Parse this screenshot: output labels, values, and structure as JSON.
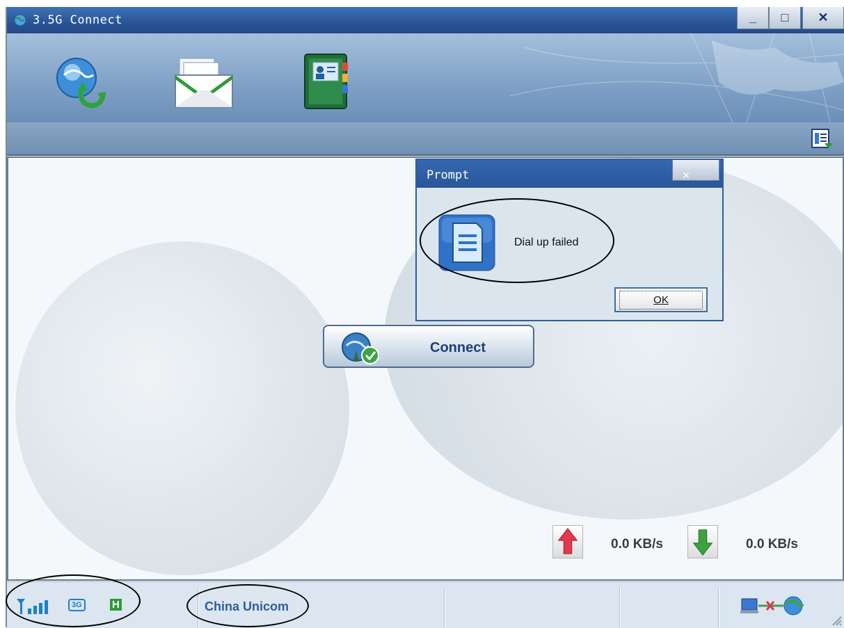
{
  "window": {
    "title": "3.5G Connect",
    "minimize_glyph": "_",
    "maximize_glyph": "□",
    "close_glyph": "✕"
  },
  "toolbar": {
    "items": [
      {
        "name": "internet-connect",
        "icon": "globe-refresh-icon"
      },
      {
        "name": "messages",
        "icon": "envelope-icon"
      },
      {
        "name": "phonebook",
        "icon": "phonebook-icon"
      }
    ],
    "menu_icon": "menu-list-icon"
  },
  "main": {
    "connect_label": "Connect",
    "upload_speed": "0.0 KB/s",
    "download_speed": "0.0 KB/s"
  },
  "dialog": {
    "title": "Prompt",
    "close_glyph": "✕",
    "message": "Dial up failed",
    "ok_label": "OK"
  },
  "status": {
    "signal_icon": "signal-strength-icon",
    "network_type": "3G",
    "roaming_mark": "H",
    "carrier": "China Unicom",
    "connection_icon": "disconnected-network-icon"
  },
  "colors": {
    "titlebar": "#2a5496",
    "toolbar": "#7fa0c5",
    "main_bg": "#f4f8fb",
    "carrier_text": "#2f5d9a",
    "connect_text": "#1f3f7a"
  }
}
